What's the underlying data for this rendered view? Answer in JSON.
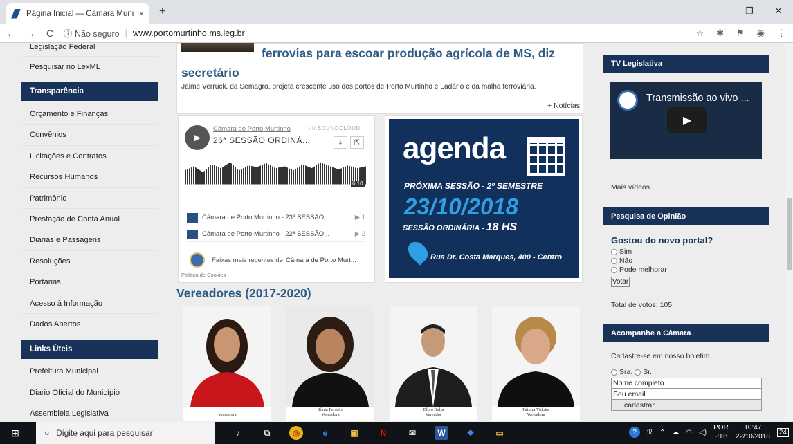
{
  "browser": {
    "tab_title": "Página Inicial — Câmara Municip",
    "close": "×",
    "new_tab": "+",
    "win_min": "—",
    "win_max": "❐",
    "win_close": "✕",
    "back": "←",
    "forward": "→",
    "reload": "C",
    "security": "ⓘ Não seguro",
    "url": "www.portomurtinho.ms.leg.br"
  },
  "sidebar": {
    "items_top": [
      "Legislação Federal",
      "Pesquisar no LexML"
    ],
    "section1": "Transparência",
    "items1": [
      "Orçamento e Finanças",
      "Convênios",
      "Licitações e Contratos",
      "Recursos Humanos",
      "Patrimônio",
      "Prestação de Conta Anual",
      "Diárias e Passagens",
      "Resoluções",
      "Portarias",
      "Acesso à Informação",
      "Dados Abertos"
    ],
    "section2": "Links Úteis",
    "items2": [
      "Prefeitura Municipal",
      "Diario Oficial do Município",
      "Assembleia Legislativa"
    ]
  },
  "news": {
    "headline_a": "ferrovias para escoar produção agrícola de MS, diz",
    "headline_b": "secretário",
    "summary": "Jaime Verruck, da Semagro, projeta crescente uso dos portos de Porto Murtinho e Ladário e da malha ferroviária.",
    "more": "+ Notícias"
  },
  "soundcloud": {
    "user": "Câmara de Porto Murtinho",
    "logo": "ıllı SOUNDCLOUD",
    "title": "26ª SESSÃO ORDINÁ...",
    "time": "6:10",
    "tracks": [
      {
        "title": "Câmara de Porto Murtinho - 23ª SESSÃO...",
        "num": "▶ 1"
      },
      {
        "title": "Câmara de Porto Murtinho - 22ª SESSÃO...",
        "num": "▶ 2"
      }
    ],
    "footer_text": "Faixas mais recentes de",
    "footer_link": "Câmara de Porto Murt...",
    "cookies": "Política de Cookies"
  },
  "agenda": {
    "word": "agenda",
    "line1": "PRÓXIMA SESSÃO - 2º SEMESTRE",
    "date": "23/10/2018",
    "line2": "SESSÃO ORDINÁRIA -",
    "time": "18 HS",
    "address": "Rua Dr. Costa Marques, 400 - Centro"
  },
  "vereadores": {
    "title": "Vereadores (2017-2020)",
    "cards": [
      {
        "name": "",
        "role": "Vereadora",
        "bg": "#f4f4f4",
        "shirt": "#c9161d"
      },
      {
        "name": "Sônia Ferreira",
        "role": "Vereadora",
        "bg": "#eaeaea",
        "shirt": "#111111"
      },
      {
        "name": "Elbio Balta",
        "role": "Vereador",
        "bg": "#f4f4f4",
        "shirt": "#1e1e1e"
      },
      {
        "name": "Fátima Vidotte",
        "role": "Vereadora",
        "bg": "#f4f4f4",
        "shirt": "#0f0f0f"
      }
    ]
  },
  "right": {
    "tv_title": "TV Legislativa",
    "video_title": "Transmissão ao vivo ...",
    "more_videos": "Mais vídeos...",
    "poll_title": "Pesquisa de Opinião",
    "poll_question": "Gostou do novo portal?",
    "options": [
      "Sim",
      "Não",
      "Pode melhorar"
    ],
    "vote": "Votar",
    "total": "Total de votos: 105",
    "follow_title": "Acompanhe a Câmara",
    "newsletter": "Cadastre-se em nosso boletim.",
    "sra": "Sra.",
    "sr": "Sr.",
    "name_value": "Nome completo",
    "email_value": "Seu email",
    "submit": "cadastrar"
  },
  "taskbar": {
    "search": "Digite aqui para pesquisar",
    "lang1": "POR",
    "lang2": "PTB",
    "time": "10:47",
    "date": "22/10/2018",
    "notif": "24"
  },
  "colors": {
    "nav_dark": "#19325a",
    "headline_blue": "#2d5b86",
    "agenda_bg": "#12305c",
    "agenda_accent": "#2f9fe3"
  }
}
